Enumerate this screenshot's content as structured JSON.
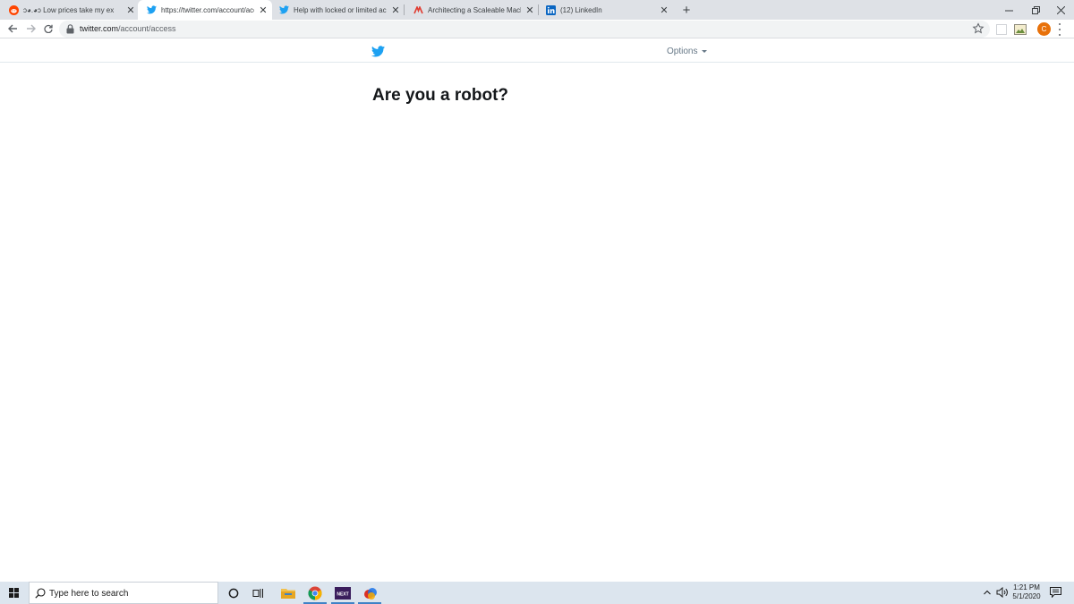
{
  "browser": {
    "tabs": [
      {
        "title": "ↄ◕.◕ↄ Low prices take my ex",
        "favicon": "reddit-icon",
        "active": false
      },
      {
        "title": "https://twitter.com/account/access",
        "favicon": "twitter-icon",
        "active": true
      },
      {
        "title": "Help with locked or limited account",
        "favicon": "twitter-icon",
        "active": false
      },
      {
        "title": "Architecting a Scaleable Machine",
        "favicon": "site-icon",
        "active": false
      },
      {
        "title": "(12) LinkedIn",
        "favicon": "linkedin-icon",
        "active": false
      }
    ],
    "address": {
      "host": "twitter.com",
      "path": "/account/access"
    },
    "profile_initial": "C"
  },
  "page": {
    "options_label": "Options",
    "title": "Are you a robot?"
  },
  "taskbar": {
    "search_placeholder": "Type here to search",
    "time": "1:21 PM",
    "date": "5/1/2020",
    "next_label": "NEXT"
  },
  "colors": {
    "twitter_blue": "#1da1f2",
    "reddit_orange": "#ff4500",
    "linkedin_blue": "#0a66c2",
    "profile_orange": "#e8710a"
  }
}
